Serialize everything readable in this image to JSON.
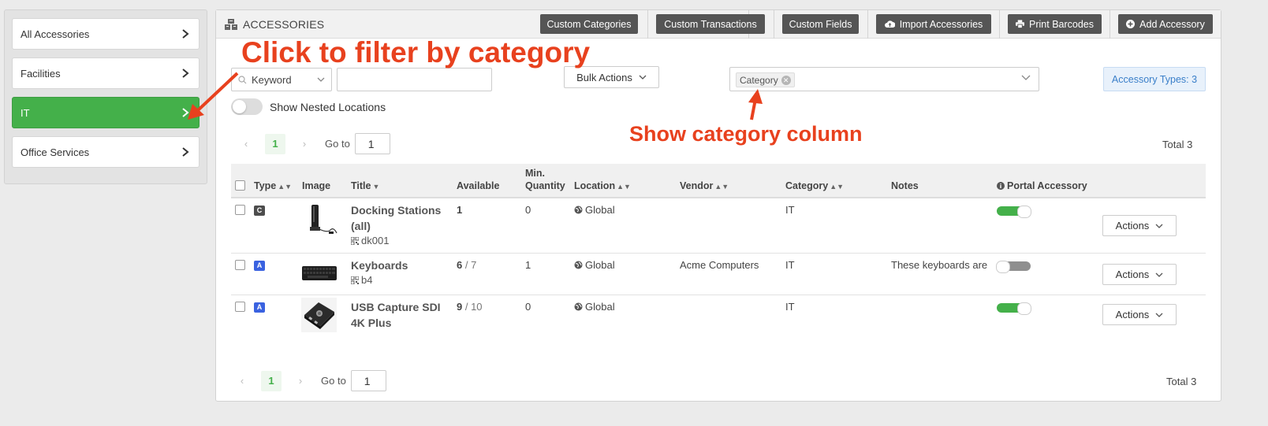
{
  "sidebar": {
    "items": [
      {
        "label": "All Accessories"
      },
      {
        "label": "Facilities"
      },
      {
        "label": "IT"
      },
      {
        "label": "Office Services"
      }
    ]
  },
  "header": {
    "title": "ACCESSORIES",
    "buttons": {
      "custom_categories": "Custom Categories",
      "custom_transactions": "Custom Transactions",
      "custom_fields": "Custom Fields",
      "import_accessories": "Import Accessories",
      "print_barcodes": "Print Barcodes",
      "add_accessory": "Add Accessory"
    }
  },
  "filters": {
    "keyword_select": "Keyword",
    "keyword_value": "",
    "bulk_actions": "Bulk Actions",
    "category_tag": "Category",
    "accessory_types": "Accessory Types: 3",
    "nested_label": "Show Nested Locations"
  },
  "pagination": {
    "current_page": "1",
    "goto_label": "Go to",
    "goto_value": "1",
    "total": "Total 3"
  },
  "table": {
    "headers": {
      "type": "Type",
      "image": "Image",
      "title": "Title",
      "available": "Available",
      "min_qty_1": "Min.",
      "min_qty_2": "Quantity",
      "location": "Location",
      "vendor": "Vendor",
      "category": "Category",
      "notes": "Notes",
      "portal": "Portal Accessory"
    },
    "rows": [
      {
        "type": "C",
        "title_line1": "Docking Stations",
        "title_line2": "(all)",
        "code": "dk001",
        "available": "1",
        "available_total": "",
        "min_qty": "0",
        "location": "Global",
        "vendor": "",
        "category": "IT",
        "notes": "",
        "portal_on": true,
        "actions": "Actions"
      },
      {
        "type": "A",
        "title_line1": "Keyboards",
        "title_line2": "",
        "code": "b4",
        "available": "6",
        "available_total": " / 7",
        "min_qty": "1",
        "location": "Global",
        "vendor": "Acme Computers",
        "category": "IT",
        "notes": "These keyboards are",
        "portal_on": false,
        "actions": "Actions"
      },
      {
        "type": "A",
        "title_line1": "USB Capture SDI",
        "title_line2": "4K Plus",
        "code": "",
        "available": "9",
        "available_total": " / 10",
        "min_qty": "0",
        "location": "Global",
        "vendor": "",
        "category": "IT",
        "notes": "",
        "portal_on": true,
        "actions": "Actions"
      }
    ]
  },
  "annotations": {
    "filter_hint": "Click to filter by category",
    "column_hint": "Show category column"
  },
  "colors": {
    "accent_green": "#44b04a",
    "annotation_red": "#e8411e",
    "badge_blue": "#3a7fc9",
    "type_c": "#4d4d4d",
    "type_a": "#3a62e0"
  }
}
